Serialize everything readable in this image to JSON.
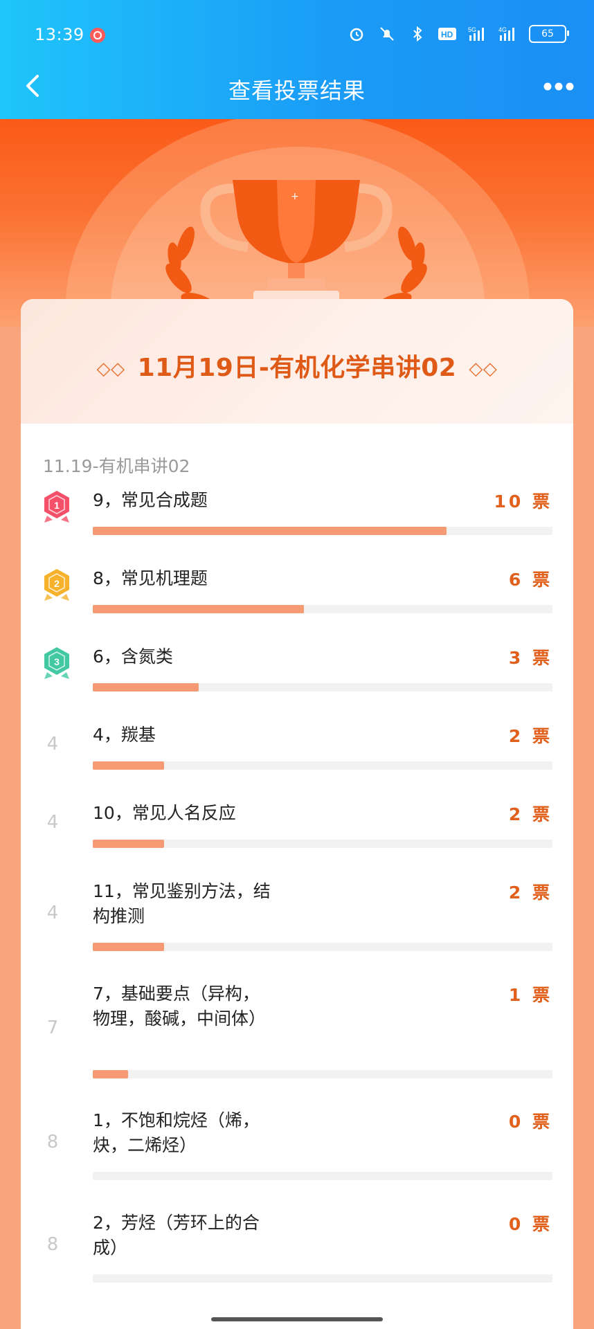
{
  "status_bar": {
    "time": "13:39",
    "battery": "65"
  },
  "nav": {
    "title": "查看投票结果"
  },
  "card": {
    "title": "11月19日-有机化学串讲02",
    "deco_left": "◇◇",
    "deco_right": "◇◇",
    "subtitle": "11.19-有机串讲02"
  },
  "unit": "票",
  "max_votes": 10,
  "options": [
    {
      "rank": "1",
      "label": "9，常见合成题",
      "votes": 10,
      "fill": 0.77,
      "badge": "gold"
    },
    {
      "rank": "2",
      "label": "8，常见机理题",
      "votes": 6,
      "fill": 0.46,
      "badge": "silver"
    },
    {
      "rank": "3",
      "label": "6，含氮类",
      "votes": 3,
      "fill": 0.23,
      "badge": "bronze"
    },
    {
      "rank": "4",
      "label": "4，羰基",
      "votes": 2,
      "fill": 0.155
    },
    {
      "rank": "4",
      "label": "10，常见人名反应",
      "votes": 2,
      "fill": 0.155
    },
    {
      "rank": "4",
      "label": "11，常见鉴别方法，结构推测",
      "votes": 2,
      "fill": 0.155
    },
    {
      "rank": "7",
      "label": "7，基础要点（异构，物理，酸碱，中间体）",
      "votes": 1,
      "fill": 0.077
    },
    {
      "rank": "8",
      "label": "1，不饱和烷烃（烯，炔，二烯烃）",
      "votes": 0,
      "fill": 0
    },
    {
      "rank": "8",
      "label": "2，芳烃（芳环上的合成）",
      "votes": 0,
      "fill": 0
    }
  ],
  "colors": {
    "accent": "#e0601c",
    "bar": "#f59a72",
    "header": "#1a9cf6"
  }
}
